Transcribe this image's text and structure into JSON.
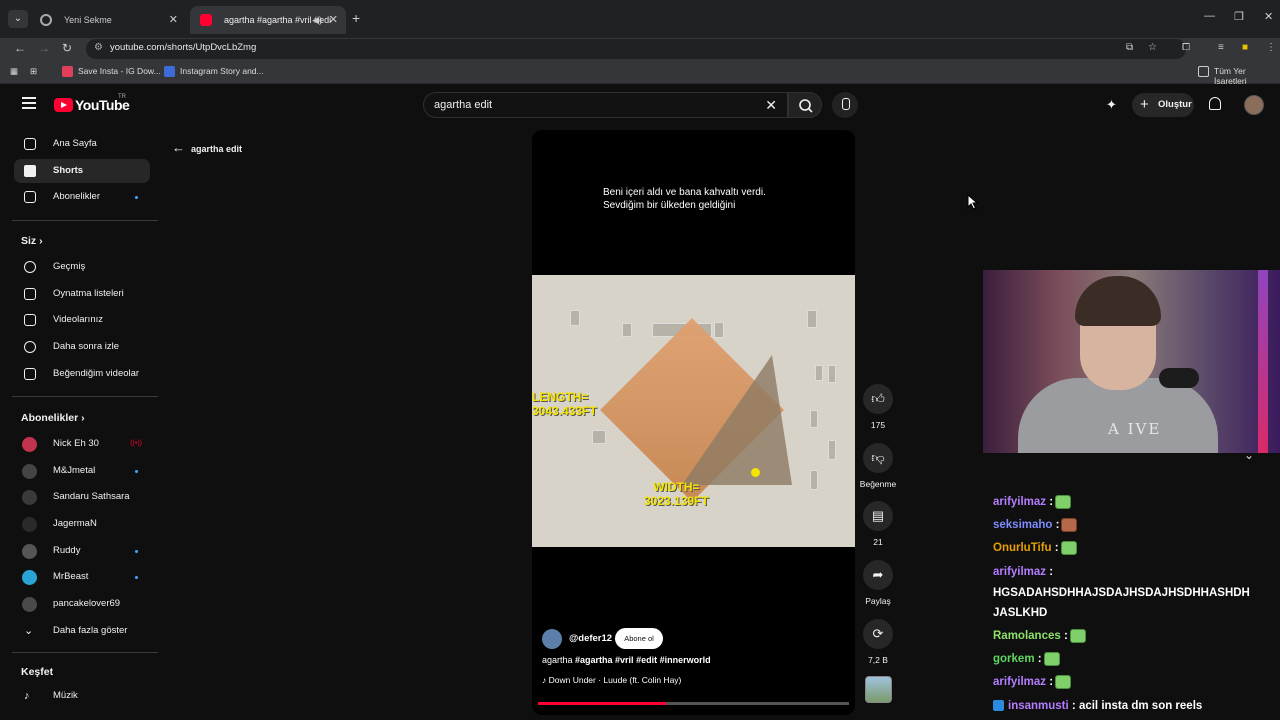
{
  "browser": {
    "tabs": [
      {
        "title": "Yeni Sekme"
      },
      {
        "title": "agartha #agartha #vril #edi"
      }
    ],
    "url": "youtube.com/shorts/UtpDvcLbZmg",
    "bookmarks": [
      {
        "label": "Save Insta - IG Dow..."
      },
      {
        "label": "Instagram Story and..."
      }
    ],
    "all_bookmarks": "Tüm Yer İşaretleri"
  },
  "header": {
    "logo_text": "YouTube",
    "region": "TR",
    "search_query": "agartha edit",
    "create_label": "Oluştur"
  },
  "sidebar": {
    "main": [
      {
        "label": "Ana Sayfa",
        "icon": "home-icon"
      },
      {
        "label": "Shorts",
        "icon": "shorts-icon"
      },
      {
        "label": "Abonelikler",
        "icon": "subscriptions-icon"
      }
    ],
    "you_heading": "Siz",
    "you": [
      {
        "label": "Geçmiş",
        "icon": "history-icon"
      },
      {
        "label": "Oynatma listeleri",
        "icon": "playlists-icon"
      },
      {
        "label": "Videolarınız",
        "icon": "your-videos-icon"
      },
      {
        "label": "Daha sonra izle",
        "icon": "watch-later-icon"
      },
      {
        "label": "Beğendiğim videolar",
        "icon": "liked-icon"
      }
    ],
    "subs_heading": "Abonelikler",
    "subs": [
      {
        "label": "Nick Eh 30",
        "color": "#c2334d",
        "status": "live"
      },
      {
        "label": "M&Jmetal",
        "color": "#444444",
        "status": "new"
      },
      {
        "label": "Sandaru Sathsara",
        "color": "#3a3a3a",
        "status": ""
      },
      {
        "label": "JagermaN",
        "color": "#2a2a2a",
        "status": ""
      },
      {
        "label": "Ruddy",
        "color": "#555555",
        "status": "new"
      },
      {
        "label": "MrBeast",
        "color": "#2aa3d6",
        "status": "new"
      },
      {
        "label": "pancakelover69",
        "color": "#4a4a4a",
        "status": ""
      }
    ],
    "show_more": "Daha fazla göster",
    "explore_heading": "Keşfet",
    "explore": [
      {
        "label": "Müzik",
        "icon": "music-icon"
      }
    ]
  },
  "page": {
    "back_label": "agartha edit"
  },
  "short": {
    "caption_line1": "Beni içeri aldı ve bana kahvaltı verdi.",
    "caption_line2": "Sevdiğim bir ülkeden geldiğini",
    "video_label_length": "LENGTH=\n3043.433FT",
    "video_label_width": "WIDTH=\n3023.139FT",
    "channel": "@defer12",
    "subscribe": "Abone ol",
    "title_plain": "agartha ",
    "title_tags": "#agartha #vril  #edit #innerworld",
    "sound": "Down Under · Luude (ft. Colin Hay)",
    "progress_fraction": 0.41,
    "likes": "175",
    "dislike_label": "Beğenme",
    "comments": "21",
    "share_label": "Paylaş",
    "remix_count": "7,2 B"
  },
  "stream": {
    "shirt_text": "A  IVE",
    "chat": [
      {
        "user": "arifyilmaz",
        "color": "#b47dff",
        "text": " :",
        "emote": "green"
      },
      {
        "user": "seksimaho",
        "color": "#7c8cff",
        "text": " :",
        "emote": "brown"
      },
      {
        "user": "OnurluTifu",
        "color": "#e8a000",
        "text": " :",
        "emote": "green"
      },
      {
        "user": "arifyilmaz",
        "color": "#b47dff",
        "text": " :",
        "emote": ""
      },
      {
        "user": "",
        "color": "#ffffff",
        "text": "HGSADAHSDHHAJSDAJHSDAJHSDHHASHDH",
        "emote": ""
      },
      {
        "user": "",
        "color": "#ffffff",
        "text": "JASLKHD",
        "emote": ""
      },
      {
        "user": "Ramolances",
        "color": "#8fe06a",
        "text": " :",
        "emote": "green"
      },
      {
        "user": "gorkem",
        "color": "#5fd65f",
        "text": " :",
        "emote": "green"
      },
      {
        "user": "arifyilmaz",
        "color": "#b47dff",
        "text": " :",
        "emote": "green"
      },
      {
        "user": "insanmusti",
        "color": "#b47dff",
        "text": " : acil insta dm son reels",
        "emote": ""
      }
    ]
  }
}
